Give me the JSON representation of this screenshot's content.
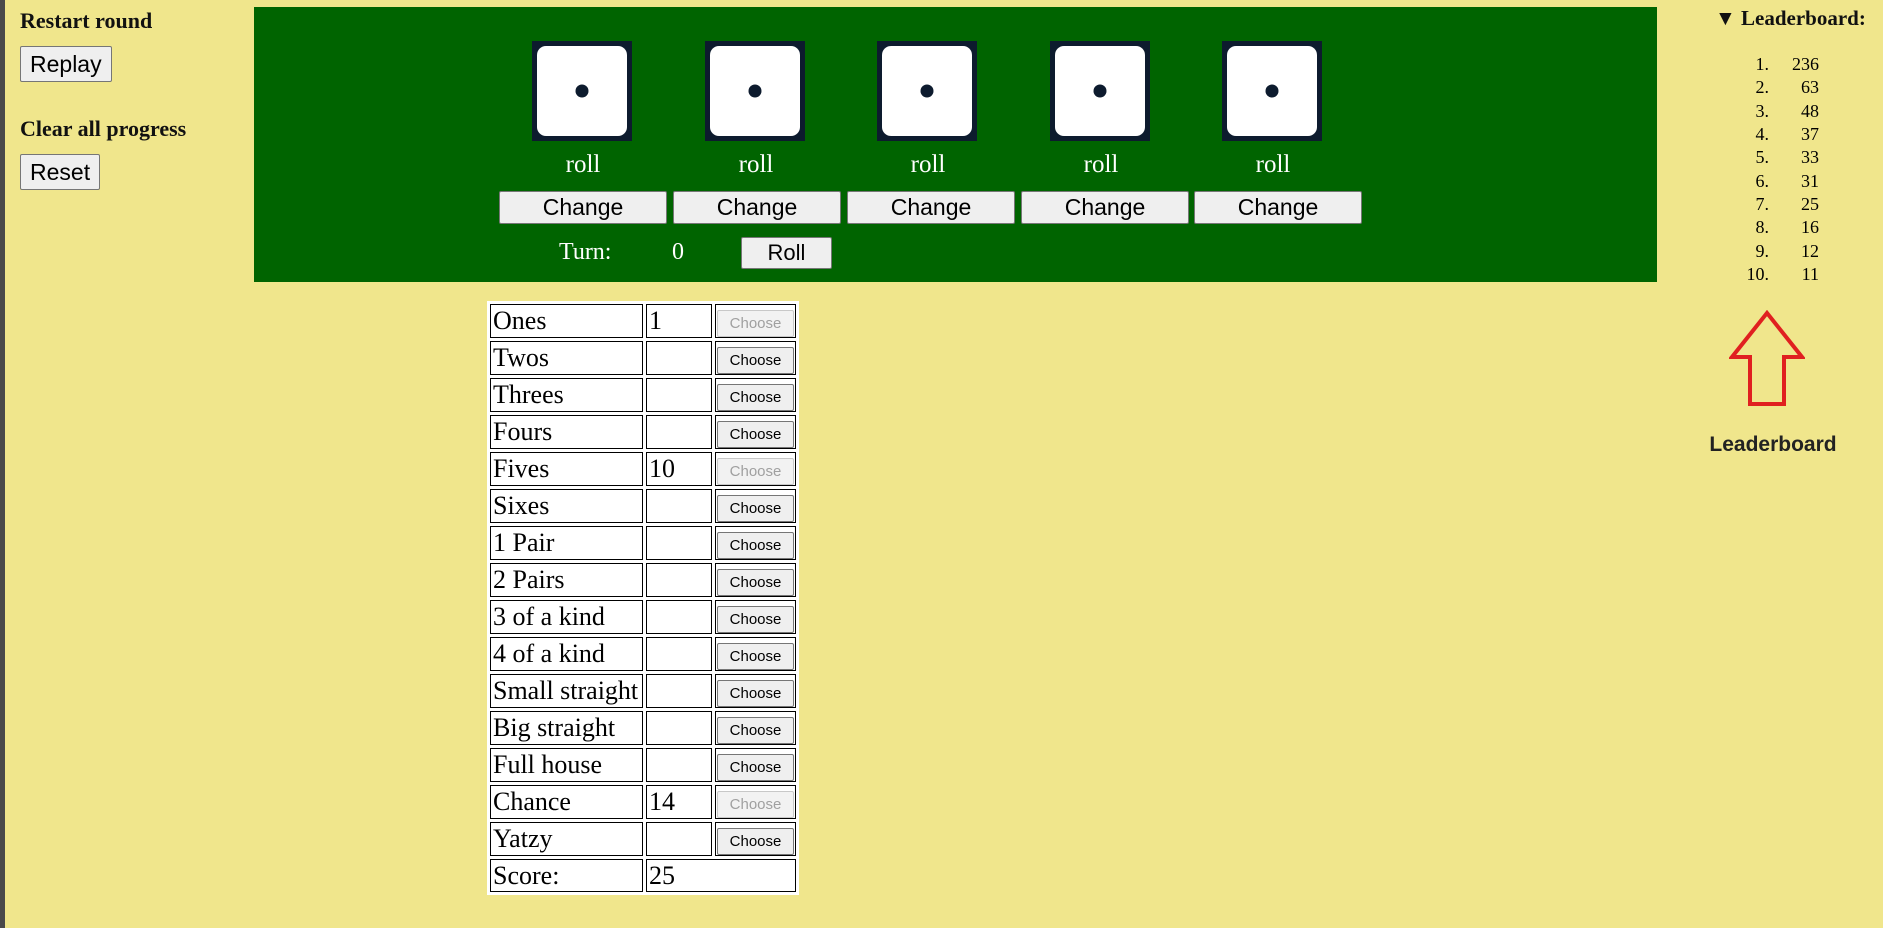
{
  "left_panel": {
    "restart_heading": "Restart round",
    "replay_label": "Replay",
    "clear_heading": "Clear all progress",
    "reset_label": "Reset"
  },
  "board": {
    "dice": [
      {
        "value": 1,
        "roll_label": "roll",
        "change_label": "Change"
      },
      {
        "value": 1,
        "roll_label": "roll",
        "change_label": "Change"
      },
      {
        "value": 1,
        "roll_label": "roll",
        "change_label": "Change"
      },
      {
        "value": 1,
        "roll_label": "roll",
        "change_label": "Change"
      },
      {
        "value": 1,
        "roll_label": "roll",
        "change_label": "Change"
      }
    ],
    "turn_label": "Turn:",
    "turn_value": "0",
    "roll_button_label": "Roll"
  },
  "scorecard": {
    "rows": [
      {
        "category": "Ones",
        "value": "1",
        "button": "Choose",
        "enabled": false
      },
      {
        "category": "Twos",
        "value": "",
        "button": "Choose",
        "enabled": true
      },
      {
        "category": "Threes",
        "value": "",
        "button": "Choose",
        "enabled": true
      },
      {
        "category": "Fours",
        "value": "",
        "button": "Choose",
        "enabled": true
      },
      {
        "category": "Fives",
        "value": "10",
        "button": "Choose",
        "enabled": false
      },
      {
        "category": "Sixes",
        "value": "",
        "button": "Choose",
        "enabled": true
      },
      {
        "category": "1 Pair",
        "value": "",
        "button": "Choose",
        "enabled": true
      },
      {
        "category": "2 Pairs",
        "value": "",
        "button": "Choose",
        "enabled": true
      },
      {
        "category": "3 of a kind",
        "value": "",
        "button": "Choose",
        "enabled": true
      },
      {
        "category": "4 of a kind",
        "value": "",
        "button": "Choose",
        "enabled": true
      },
      {
        "category": "Small straight",
        "value": "",
        "button": "Choose",
        "enabled": true
      },
      {
        "category": "Big straight",
        "value": "",
        "button": "Choose",
        "enabled": true
      },
      {
        "category": "Full house",
        "value": "",
        "button": "Choose",
        "enabled": true
      },
      {
        "category": "Chance",
        "value": "14",
        "button": "Choose",
        "enabled": false
      },
      {
        "category": "Yatzy",
        "value": "",
        "button": "Choose",
        "enabled": true
      }
    ],
    "score_label": "Score:",
    "score_value": "25"
  },
  "leaderboard": {
    "title": "▼ Leaderboard:",
    "entries": [
      {
        "rank": "1.",
        "score": "236"
      },
      {
        "rank": "2.",
        "score": "63"
      },
      {
        "rank": "3.",
        "score": "48"
      },
      {
        "rank": "4.",
        "score": "37"
      },
      {
        "rank": "5.",
        "score": "33"
      },
      {
        "rank": "6.",
        "score": "31"
      },
      {
        "rank": "7.",
        "score": "25"
      },
      {
        "rank": "8.",
        "score": "16"
      },
      {
        "rank": "9.",
        "score": "12"
      },
      {
        "rank": "10.",
        "score": "11"
      }
    ],
    "arrow_caption": "Leaderboard",
    "arrow_color": "#e02020"
  },
  "colors": {
    "background": "#f0e68c",
    "board": "#006400",
    "die_frame": "#0d1b2e"
  }
}
